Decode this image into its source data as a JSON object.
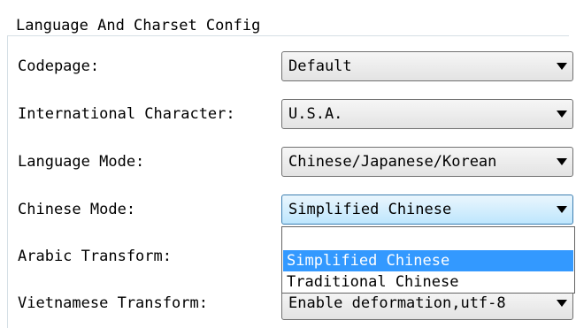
{
  "group": {
    "title": "Language And Charset Config"
  },
  "rows": [
    {
      "label": "Codepage:",
      "value": "Default"
    },
    {
      "label": "International Character:",
      "value": "U.S.A."
    },
    {
      "label": "Language Mode:",
      "value": "Chinese/Japanese/Korean"
    },
    {
      "label": "Chinese Mode:",
      "value": "Simplified Chinese"
    },
    {
      "label": "Arabic Transform:",
      "value": ""
    },
    {
      "label": "Vietnamese Transform:",
      "value": "Enable deformation,utf-8"
    }
  ],
  "dropdown": {
    "options": [
      "",
      "Simplified Chinese",
      "Traditional Chinese"
    ],
    "selected": "Simplified Chinese"
  },
  "colors": {
    "selection": "#3399ff",
    "focus_border": "#3c7fb1"
  }
}
